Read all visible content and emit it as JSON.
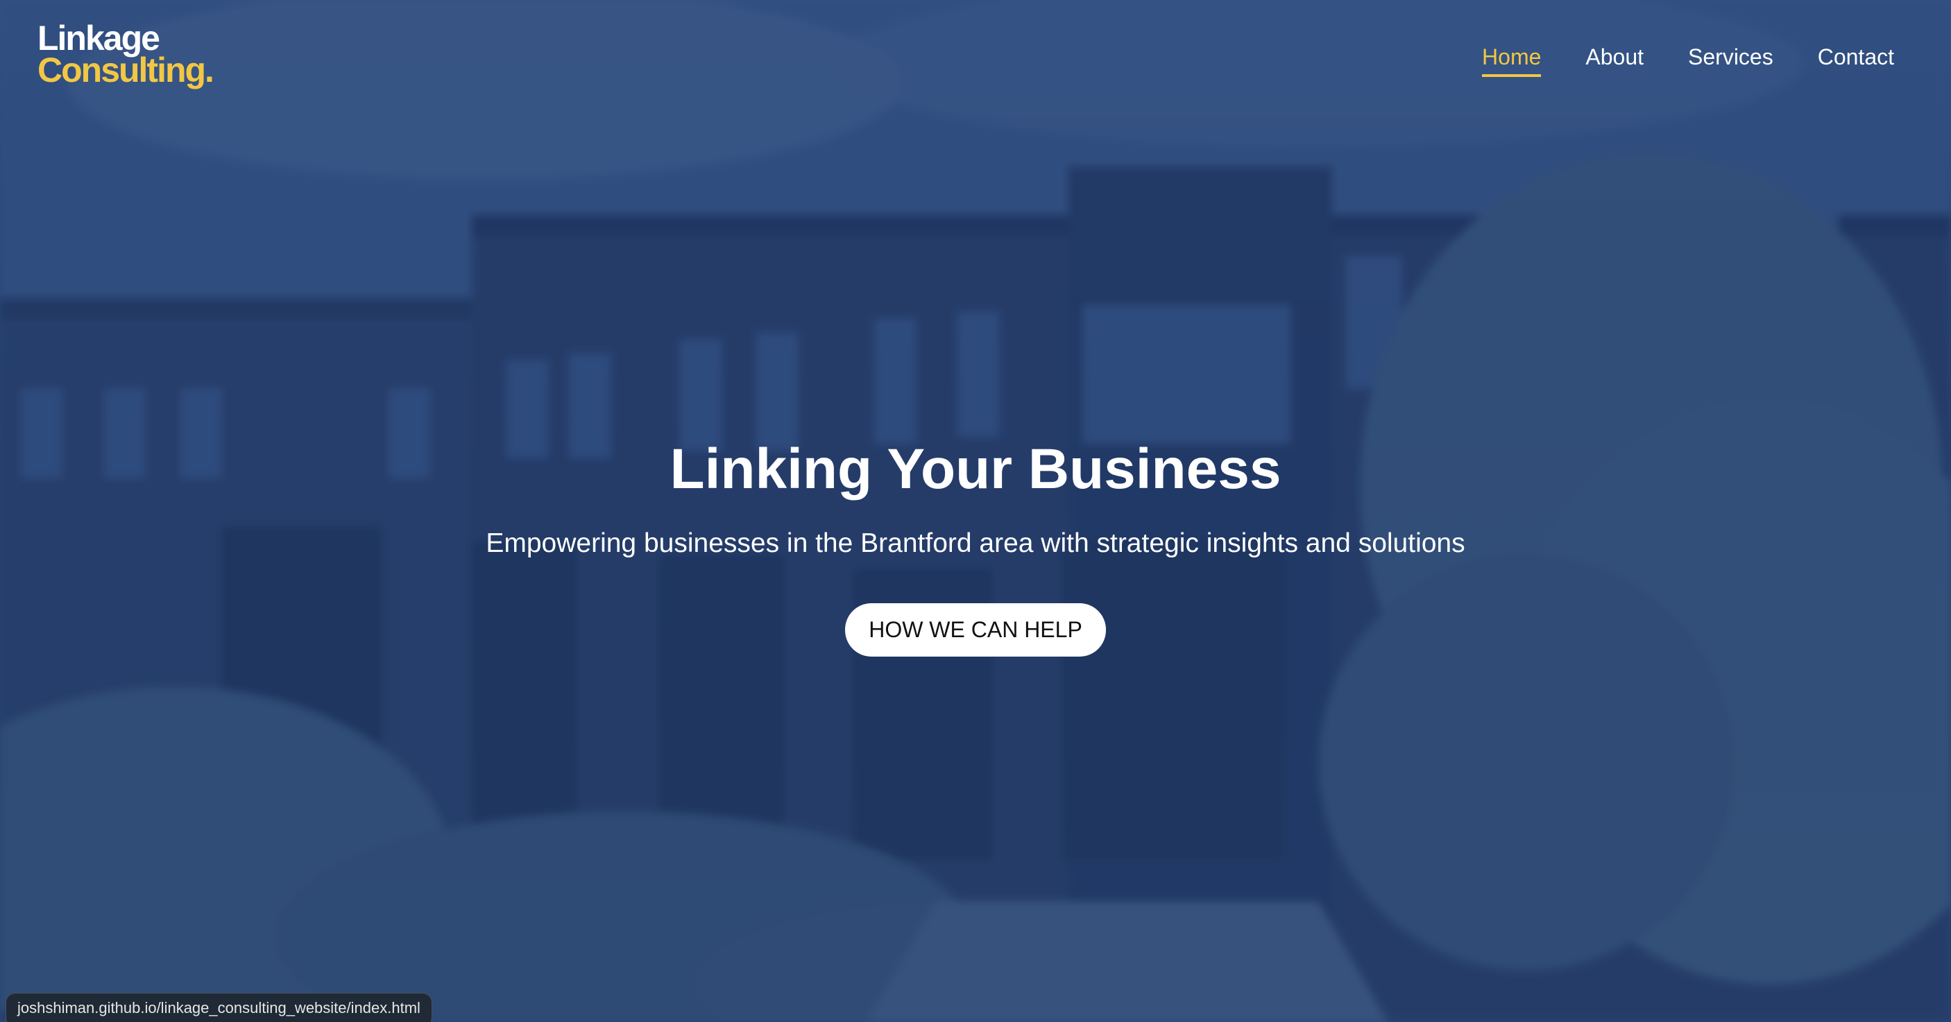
{
  "brand": {
    "line1": "Linkage",
    "line2": "Consulting.",
    "accent_color": "#f2c744"
  },
  "nav": {
    "items": [
      {
        "label": "Home",
        "active": true
      },
      {
        "label": "About",
        "active": false
      },
      {
        "label": "Services",
        "active": false
      },
      {
        "label": "Contact",
        "active": false
      }
    ]
  },
  "hero": {
    "title": "Linking Your Business",
    "subtitle": "Empowering businesses in the Brantford area with strategic insights and solutions",
    "cta_label": "HOW WE CAN HELP"
  },
  "status": {
    "url": "joshshiman.github.io/linkage_consulting_website/index.html"
  }
}
